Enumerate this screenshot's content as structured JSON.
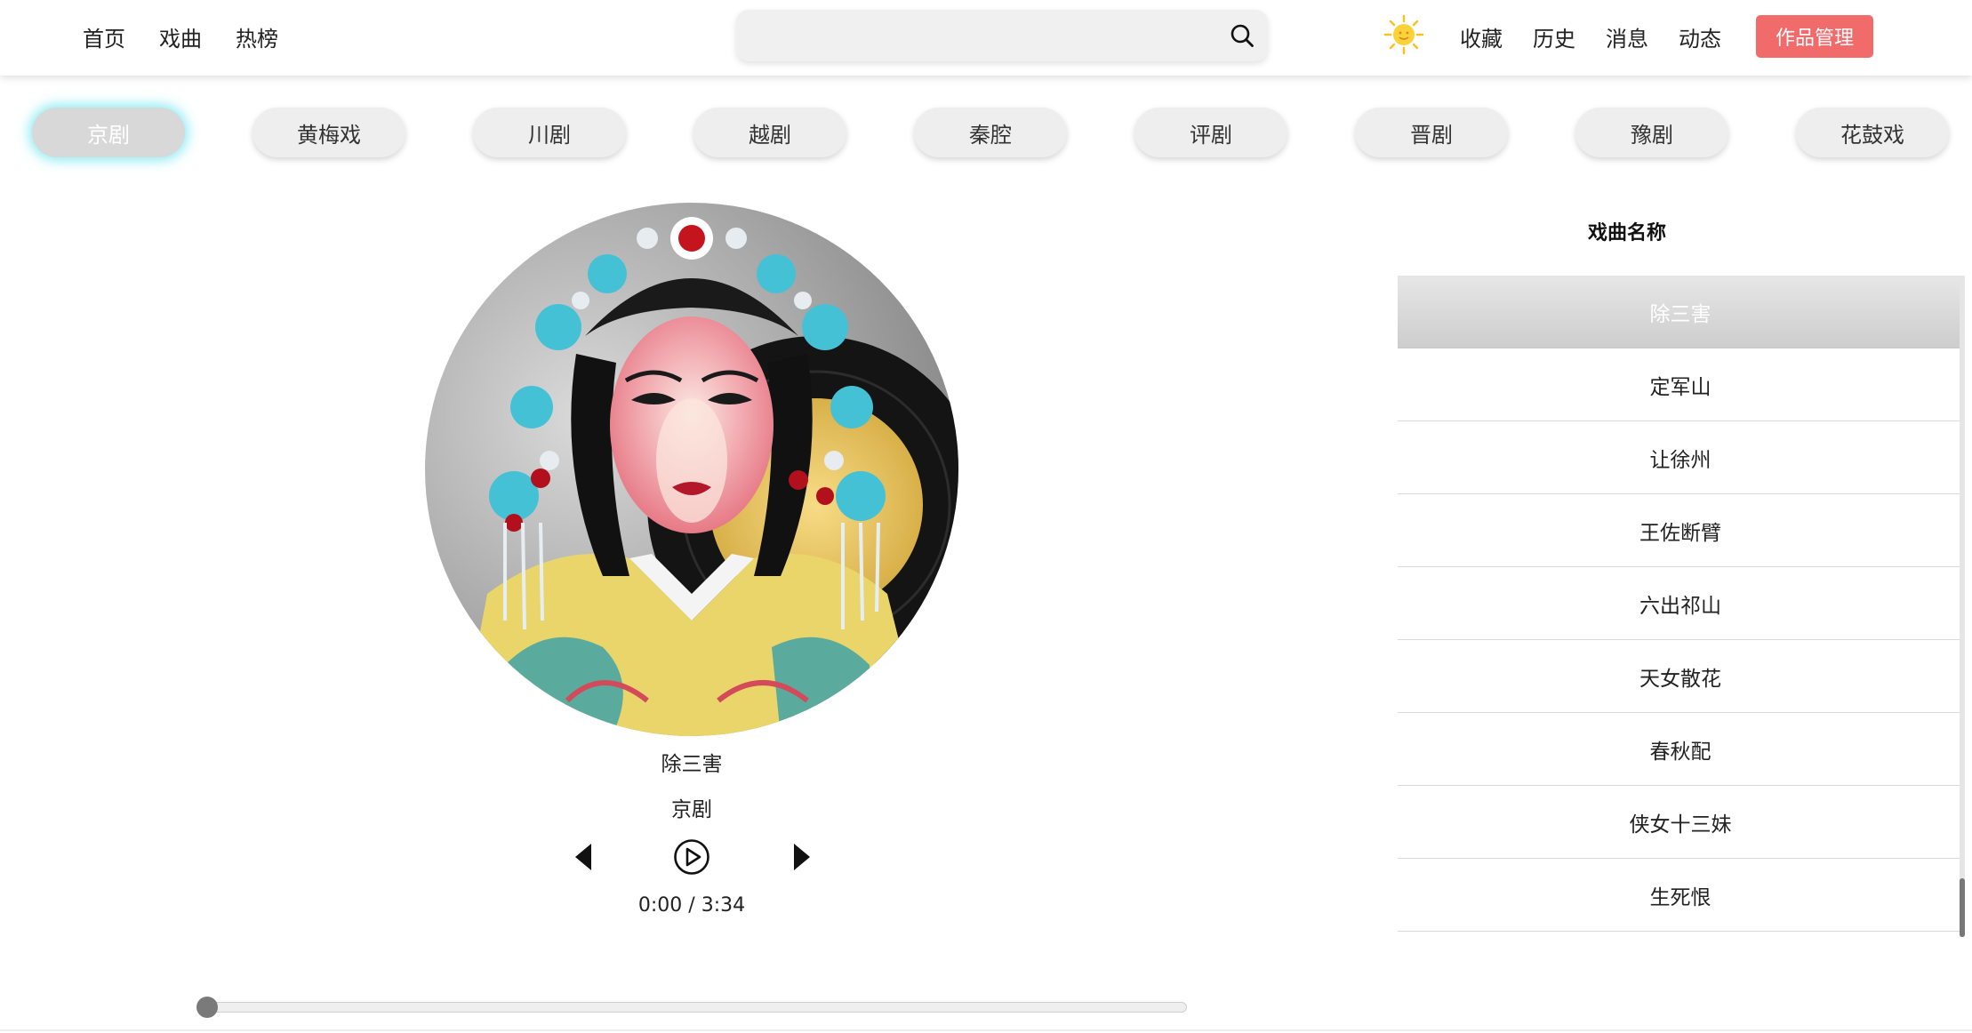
{
  "nav": {
    "left": [
      {
        "label": "首页"
      },
      {
        "label": "戏曲"
      },
      {
        "label": "热榜"
      }
    ],
    "right": [
      {
        "label": "收藏"
      },
      {
        "label": "历史"
      },
      {
        "label": "消息"
      },
      {
        "label": "动态"
      }
    ],
    "manage_label": "作品管理"
  },
  "search": {
    "value": "",
    "placeholder": "",
    "icon": "search-icon"
  },
  "weather": {
    "icon": "sun-icon"
  },
  "categories": [
    {
      "label": "京剧",
      "active": true
    },
    {
      "label": "黄梅戏",
      "active": false
    },
    {
      "label": "川剧",
      "active": false
    },
    {
      "label": "越剧",
      "active": false
    },
    {
      "label": "秦腔",
      "active": false
    },
    {
      "label": "评剧",
      "active": false
    },
    {
      "label": "晋剧",
      "active": false
    },
    {
      "label": "豫剧",
      "active": false
    },
    {
      "label": "花鼓戏",
      "active": false
    }
  ],
  "player": {
    "title": "除三害",
    "genre": "京剧",
    "time": "0:00 / 3:34",
    "progress": 0.0
  },
  "playlist": {
    "header": "戏曲名称",
    "items": [
      {
        "label": "除三害",
        "active": true
      },
      {
        "label": "定军山",
        "active": false
      },
      {
        "label": "让徐州",
        "active": false
      },
      {
        "label": "王佐断臂",
        "active": false
      },
      {
        "label": "六出祁山",
        "active": false
      },
      {
        "label": "天女散花",
        "active": false
      },
      {
        "label": "春秋配",
        "active": false
      },
      {
        "label": "侠女十三妹",
        "active": false
      },
      {
        "label": "生死恨",
        "active": false
      }
    ]
  },
  "colors": {
    "accent": "#f26b6b",
    "active_glow": "#6ee6f0"
  }
}
